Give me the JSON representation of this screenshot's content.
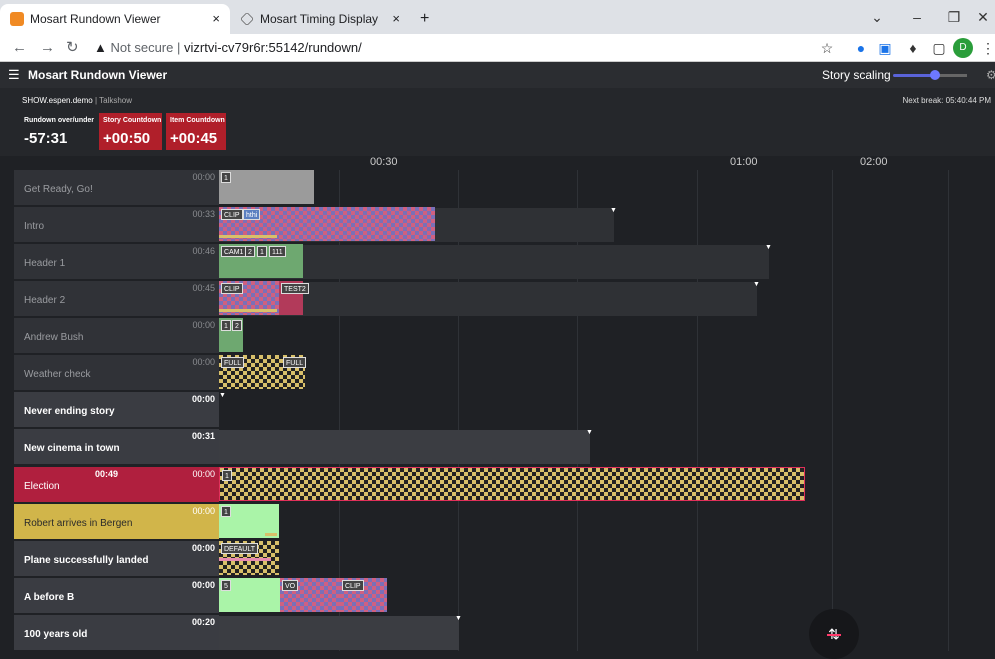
{
  "browser": {
    "tabs": [
      {
        "title": "Mosart Rundown Viewer",
        "close": "×"
      },
      {
        "title": "Mosart Timing Display",
        "close": "×"
      }
    ],
    "new_tab": "+",
    "url_prefix": "Not secure",
    "url": "vizrtvi-cv79r6r:55142/rundown/",
    "profile_initial": "D"
  },
  "app": {
    "title": "Mosart Rundown Viewer",
    "scaling_label": "Story scaling",
    "scaling_value": 0.55,
    "show_name": "SHOW.espen.demo",
    "show_type": "Talkshow",
    "next_break_label": "Next break:",
    "next_break_time": "05:40:44 PM",
    "counters": [
      {
        "label": "Rundown over/under",
        "value": "-57:31",
        "color": "#25272b"
      },
      {
        "label": "Story Countdown",
        "value": "+00:50",
        "color": "#b01f2a"
      },
      {
        "label": "Item Countdown",
        "value": "+00:45",
        "color": "#b01f2a"
      }
    ],
    "axis_ticks": [
      "00:30",
      "01:00",
      "02:00"
    ]
  },
  "rows": [
    {
      "name": "Get Ready, Go!",
      "time": "00:00",
      "state": "done"
    },
    {
      "name": "Intro",
      "time": "00:33",
      "state": "done"
    },
    {
      "name": "Header 1",
      "time": "00:46",
      "state": "done"
    },
    {
      "name": "Header 2",
      "time": "00:45",
      "state": "done"
    },
    {
      "name": "Andrew Bush",
      "time": "00:00",
      "state": "done"
    },
    {
      "name": "Weather check",
      "time": "00:00",
      "state": "done"
    },
    {
      "name": "Never ending story",
      "time": "00:00",
      "state": "current"
    },
    {
      "name": "New cinema in town",
      "time": "00:31",
      "state": "current"
    },
    {
      "name": "Election",
      "time": "00:00",
      "elapsed": "00:49",
      "state": "onair"
    },
    {
      "name": "Robert arrives in Bergen",
      "time": "00:00",
      "state": "next"
    },
    {
      "name": "Plane successfully landed",
      "time": "00:00",
      "state": "current"
    },
    {
      "name": "A before B",
      "time": "00:00",
      "state": "current"
    },
    {
      "name": "100 years old",
      "time": "00:20",
      "state": "current"
    }
  ],
  "tags": {
    "r0": [
      "1"
    ],
    "r1": [
      "CLIP",
      "hthi"
    ],
    "r2": [
      "CAM1",
      "2",
      "1",
      "111"
    ],
    "r3": [
      "CLIP",
      "TEST2"
    ],
    "r4": [
      "1",
      "2"
    ],
    "r5": [
      "FULL",
      "FULL"
    ],
    "r8": [
      "1"
    ],
    "r9": [
      "1"
    ],
    "r10": [
      "DEFAULT"
    ],
    "r11": [
      "5",
      "VO",
      "CLIP"
    ]
  }
}
